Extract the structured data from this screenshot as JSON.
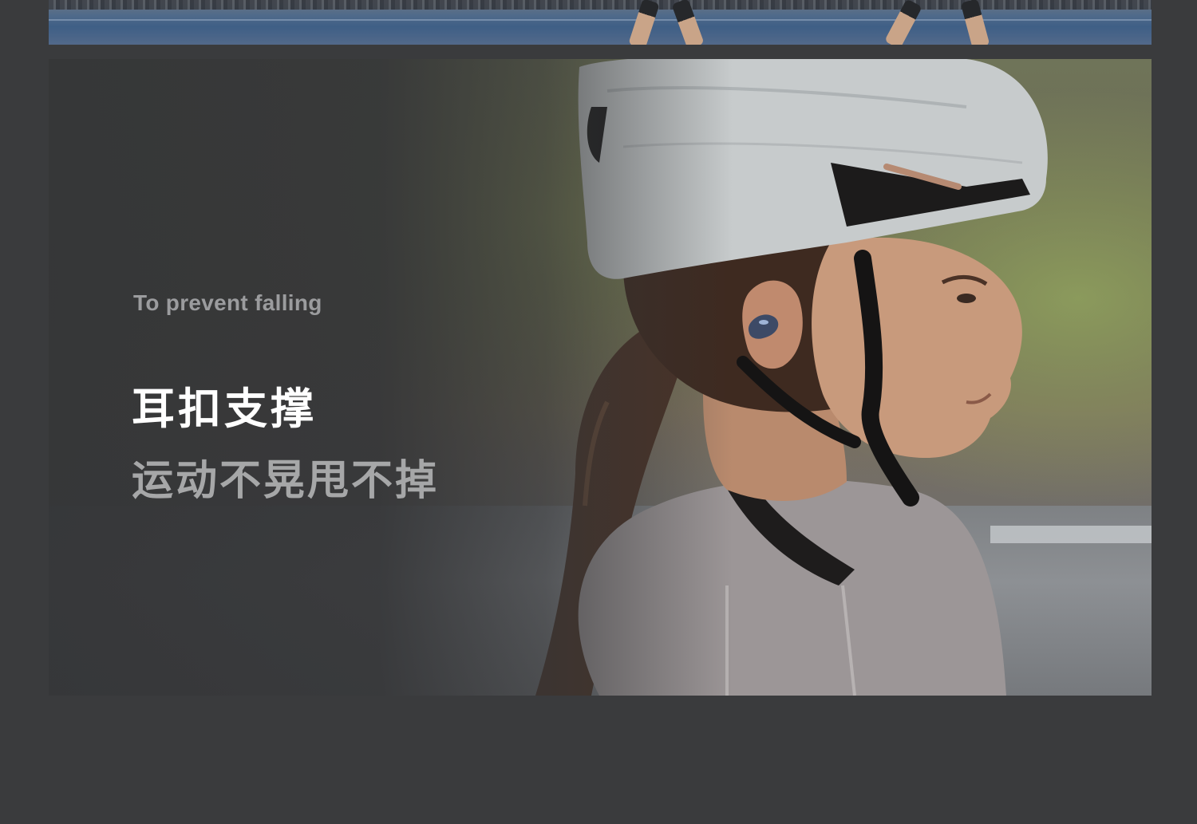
{
  "hero": {
    "tagline": "To prevent falling",
    "title": "耳扣支撑",
    "subtitle": "运动不晃甩不掉"
  },
  "colors": {
    "background": "#3a3b3d",
    "title": "#ffffff",
    "subtitle": "#a6a7a8",
    "tagline": "#9b9c9e"
  }
}
